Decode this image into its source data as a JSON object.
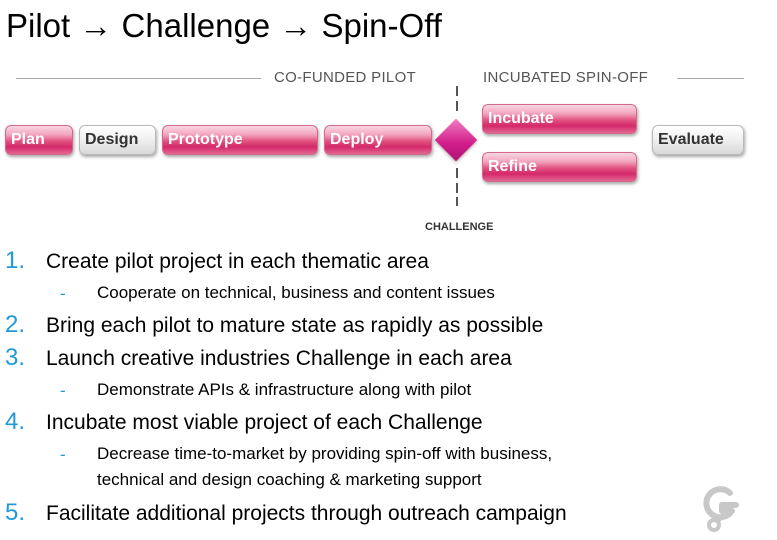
{
  "title": "Pilot → Challenge → Spin-Off",
  "diagram": {
    "phase_left": "CO-FUNDED PILOT",
    "phase_right": "INCUBATED SPIN-OFF",
    "stages": {
      "plan": "Plan",
      "design": "Design",
      "prototype": "Prototype",
      "deploy": "Deploy",
      "incubate": "Incubate",
      "refine": "Refine",
      "evaluate": "Evaluate"
    },
    "challenge_label": "CHALLENGE"
  },
  "list": [
    {
      "number": "1.",
      "text": "Create pilot project in each thematic area",
      "subs": [
        "Cooperate on technical, business and content issues"
      ]
    },
    {
      "number": "2.",
      "text": "Bring each pilot to mature state as rapidly as possible",
      "subs": []
    },
    {
      "number": "3.",
      "text": "Launch creative industries Challenge in each area",
      "subs": [
        "Demonstrate APIs & infrastructure along with pilot"
      ]
    },
    {
      "number": "4.",
      "text": "Incubate most viable project of each Challenge",
      "subs": [
        "Decrease time-to-market by providing spin-off with business,",
        "technical and design coaching & marketing support"
      ]
    },
    {
      "number": "5.",
      "text": "Facilitate additional projects through outreach campaign",
      "subs": []
    }
  ],
  "sub_marker": "-",
  "colors": {
    "accent_blue": "#1f9ad6",
    "stage_pink": "#d4286a",
    "diamond_magenta": "#d11c8a"
  },
  "icons": {
    "logo": "swirl-logo-icon"
  }
}
